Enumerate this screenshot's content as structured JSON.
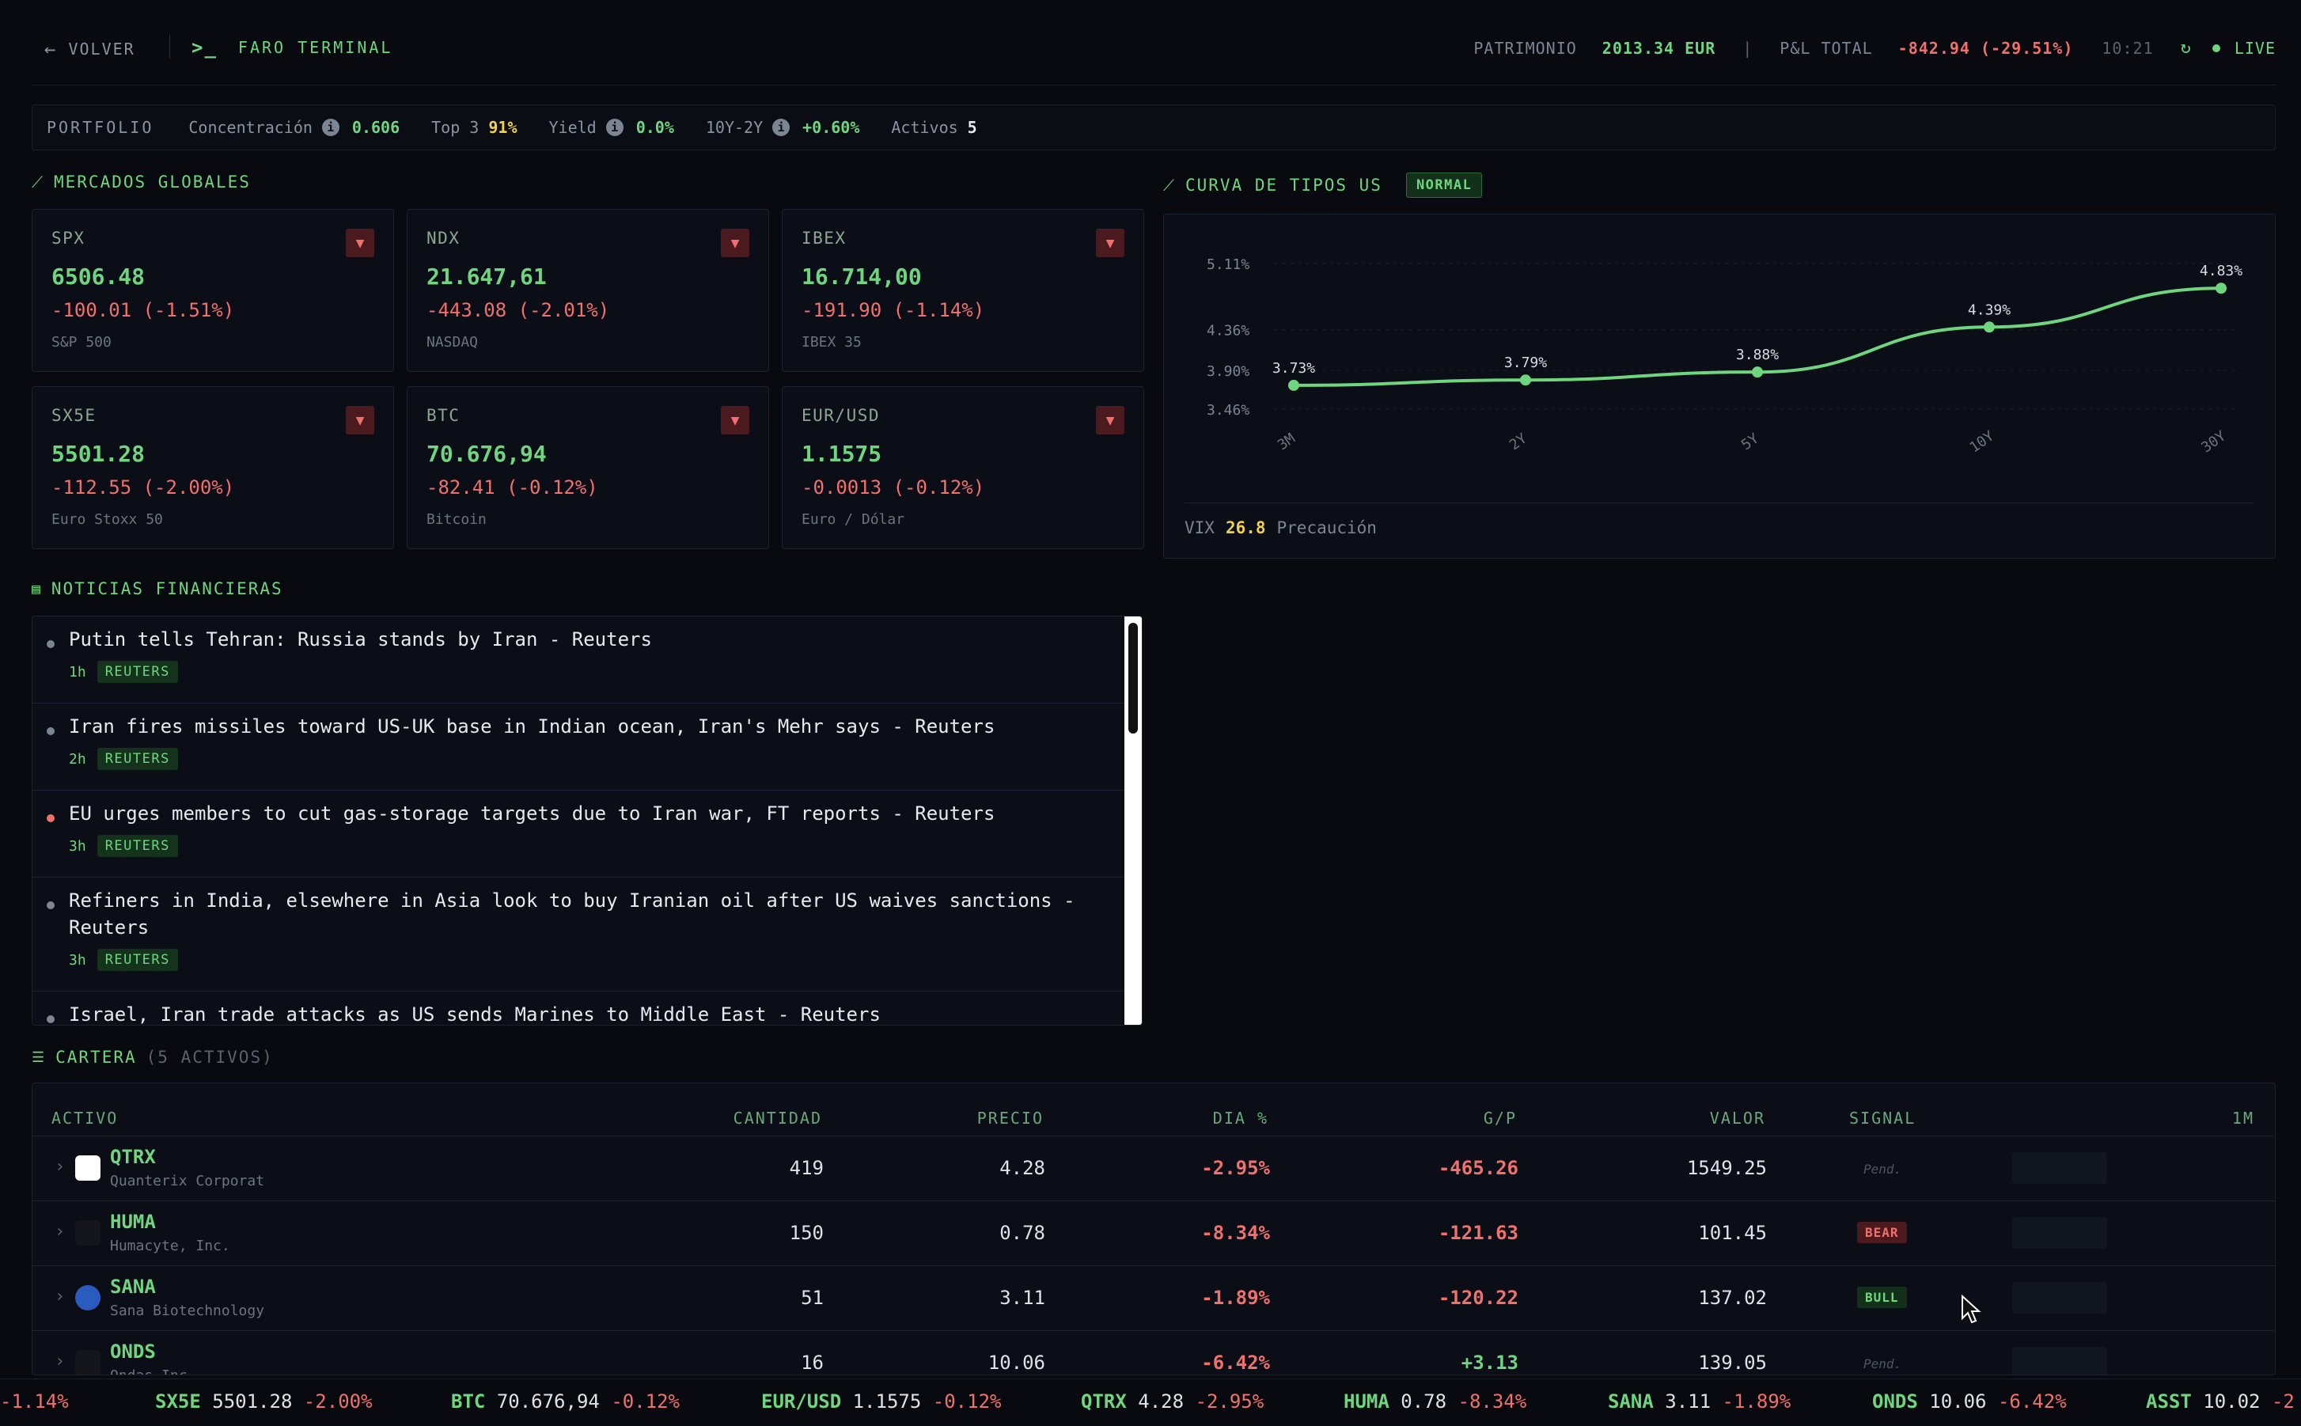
{
  "header": {
    "back_label": "VOLVER",
    "app_title": "FARO TERMINAL",
    "patrimonio_label": "PATRIMONIO",
    "patrimonio_value": "2013.34 EUR",
    "separator": "|",
    "pnl_label": "P&L TOTAL",
    "pnl_value": "-842.94 (-29.51%)",
    "time": "10:21",
    "live_label": "LIVE"
  },
  "portfolio": {
    "label": "PORTFOLIO",
    "concentracion_label": "Concentración",
    "concentracion_value": "0.606",
    "top3_label": "Top 3",
    "top3_value": "91%",
    "yield_label": "Yield",
    "yield_value": "0.0%",
    "spread_label": "10Y-2Y",
    "spread_value": "+0.60%",
    "activos_label": "Activos",
    "activos_value": "5"
  },
  "markets": {
    "title": "MERCADOS GLOBALES",
    "cards": [
      {
        "symbol": "SPX",
        "price": "6506.48",
        "change": "-100.01 (-1.51%)",
        "name": "S&P 500",
        "arrow": "▼"
      },
      {
        "symbol": "NDX",
        "price": "21.647,61",
        "change": "-443.08 (-2.01%)",
        "name": "NASDAQ",
        "arrow": "▼"
      },
      {
        "symbol": "IBEX",
        "price": "16.714,00",
        "change": "-191.90 (-1.14%)",
        "name": "IBEX 35",
        "arrow": "▼"
      },
      {
        "symbol": "SX5E",
        "price": "5501.28",
        "change": "-112.55 (-2.00%)",
        "name": "Euro Stoxx 50",
        "arrow": "▼"
      },
      {
        "symbol": "BTC",
        "price": "70.676,94",
        "change": "-82.41 (-0.12%)",
        "name": "Bitcoin",
        "arrow": "▼"
      },
      {
        "symbol": "EUR/USD",
        "price": "1.1575",
        "change": "-0.0013 (-0.12%)",
        "name": "Euro / Dólar",
        "arrow": "▼"
      }
    ]
  },
  "yield_curve": {
    "title": "CURVA DE TIPOS US",
    "badge": "NORMAL",
    "vix_label": "VIX",
    "vix_value": "26.8",
    "vix_status": "Precaución"
  },
  "chart_data": {
    "type": "line",
    "categories": [
      "3M",
      "2Y",
      "5Y",
      "10Y",
      "30Y"
    ],
    "values": [
      3.73,
      3.79,
      3.88,
      4.39,
      4.83
    ],
    "data_labels": [
      "3.73%",
      "3.79%",
      "3.88%",
      "4.39%",
      "4.83%"
    ],
    "y_ticks": [
      3.46,
      3.9,
      4.36,
      5.11
    ],
    "y_tick_labels": [
      "3.46%",
      "3.90%",
      "4.36%",
      "5.11%"
    ],
    "ylim": [
      3.46,
      5.11
    ],
    "grid": true,
    "color": "#6fd67f"
  },
  "news": {
    "title": "NOTICIAS FINANCIERAS",
    "items": [
      {
        "title": "Putin tells Tehran: Russia stands by Iran - Reuters",
        "age": "1h",
        "source": "REUTERS",
        "dot": "#8a919c"
      },
      {
        "title": "Iran fires missiles toward US-UK base in Indian ocean, Iran's Mehr says - Reuters",
        "age": "2h",
        "source": "REUTERS",
        "dot": "#8a919c"
      },
      {
        "title": "EU urges members to cut gas-storage targets due to Iran war, FT reports - Reuters",
        "age": "3h",
        "source": "REUTERS",
        "dot": "#f2706b"
      },
      {
        "title": "Refiners in India, elsewhere in Asia look to buy Iranian oil after US waives sanctions - Reuters",
        "age": "3h",
        "source": "REUTERS",
        "dot": "#8a919c"
      },
      {
        "title": "Israel, Iran trade attacks as US sends Marines to Middle East - Reuters",
        "age": "",
        "source": "",
        "dot": "#8a919c"
      }
    ]
  },
  "cartera": {
    "title": "CARTERA",
    "count": "(5 ACTIVOS)",
    "columns": [
      "ACTIVO",
      "CANTIDAD",
      "PRECIO",
      "DIA %",
      "G/P",
      "VALOR",
      "SIGNAL",
      "1M"
    ],
    "rows": [
      {
        "ticker": "QTRX",
        "name": "Quanterix Corporat",
        "qty": "419",
        "price": "4.28",
        "day": "-2.95%",
        "pl": "-465.26",
        "value": "1549.25",
        "signal": "Pend.",
        "logo": "#ffffff"
      },
      {
        "ticker": "HUMA",
        "name": "Humacyte, Inc.",
        "qty": "150",
        "price": "0.78",
        "day": "-8.34%",
        "pl": "-121.63",
        "value": "101.45",
        "signal": "BEAR",
        "logo": "#1a1d24"
      },
      {
        "ticker": "SANA",
        "name": "Sana Biotechnology",
        "qty": "51",
        "price": "3.11",
        "day": "-1.89%",
        "pl": "-120.22",
        "value": "137.02",
        "signal": "BULL",
        "logo": "#2a5bbf"
      },
      {
        "ticker": "ONDS",
        "name": "Ondas Inc.",
        "qty": "16",
        "price": "10.06",
        "day": "-6.42%",
        "pl": "+3.13",
        "value": "139.05",
        "signal": "Pend.",
        "logo": "#1a1d24"
      }
    ]
  },
  "ticker": [
    {
      "sym": "",
      "price": "",
      "chg": "-1.14%"
    },
    {
      "sym": "SX5E",
      "price": "5501.28",
      "chg": "-2.00%"
    },
    {
      "sym": "BTC",
      "price": "70.676,94",
      "chg": "-0.12%"
    },
    {
      "sym": "EUR/USD",
      "price": "1.1575",
      "chg": "-0.12%"
    },
    {
      "sym": "QTRX",
      "price": "4.28",
      "chg": "-2.95%"
    },
    {
      "sym": "HUMA",
      "price": "0.78",
      "chg": "-8.34%"
    },
    {
      "sym": "SANA",
      "price": "3.11",
      "chg": "-1.89%"
    },
    {
      "sym": "ONDS",
      "price": "10.06",
      "chg": "-6.42%"
    },
    {
      "sym": "ASST",
      "price": "10.02",
      "chg": "-2"
    }
  ]
}
